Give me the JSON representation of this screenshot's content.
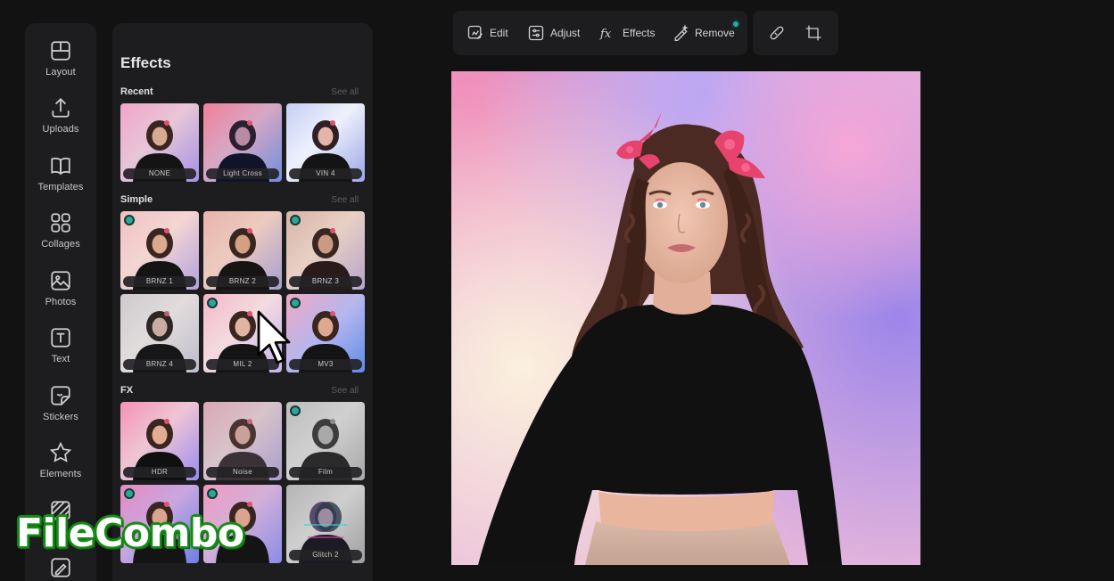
{
  "sidebar": {
    "items": [
      {
        "label": "Layout",
        "icon": "layout-icon"
      },
      {
        "label": "Uploads",
        "icon": "upload-icon"
      },
      {
        "label": "Templates",
        "icon": "templates-icon"
      },
      {
        "label": "Collages",
        "icon": "collages-icon"
      },
      {
        "label": "Photos",
        "icon": "photos-icon"
      },
      {
        "label": "Text",
        "icon": "text-icon"
      },
      {
        "label": "Stickers",
        "icon": "stickers-icon"
      },
      {
        "label": "Elements",
        "icon": "elements-icon"
      }
    ]
  },
  "panel": {
    "title": "Effects",
    "see_all": "See all",
    "sections": [
      {
        "title": "Recent",
        "items": [
          "NONE",
          "Light Cross",
          "VIN 4"
        ]
      },
      {
        "title": "Simple",
        "items": [
          "BRNZ 1",
          "BRNZ 2",
          "BRNZ 3",
          "BRNZ 4",
          "MIL 2",
          "MV3"
        ]
      },
      {
        "title": "FX",
        "items": [
          "HDR",
          "Noise",
          "Film",
          "",
          "",
          "Glitch 2"
        ]
      }
    ]
  },
  "toolbar": {
    "edit": "Edit",
    "adjust": "Adjust",
    "effects": "Effects",
    "remove": "Remove"
  },
  "watermark": "FileCombo",
  "colors": {
    "premium_badge": "#2aa79b",
    "panel_bg": "#1d1d1f",
    "app_bg": "#121212"
  }
}
